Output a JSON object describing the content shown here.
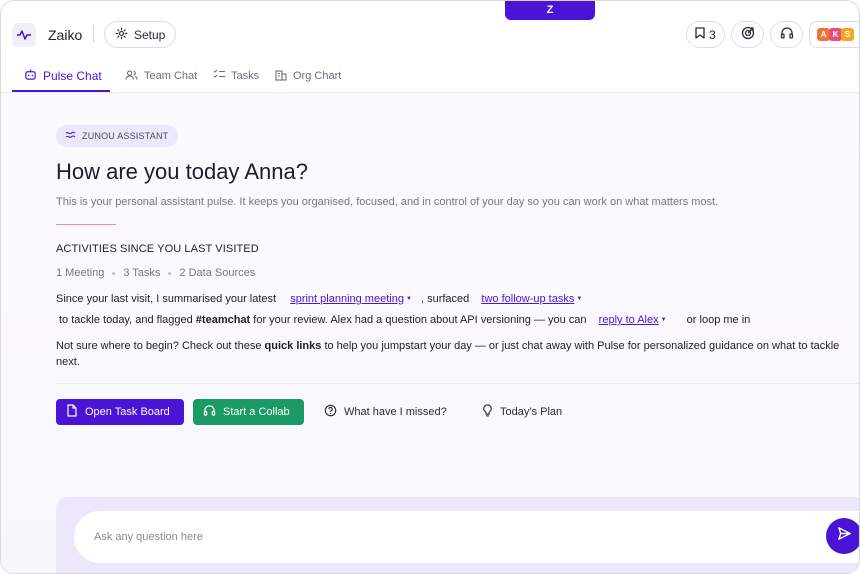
{
  "notch": {
    "label": "Z"
  },
  "header": {
    "brand": "Zaiko",
    "setup_label": "Setup",
    "bookmark_count": "3",
    "avatars": [
      {
        "letter": "A",
        "color": "#f0753b"
      },
      {
        "letter": "K",
        "color": "#e64f7a"
      },
      {
        "letter": "S",
        "color": "#f5a623"
      }
    ]
  },
  "tabs": [
    {
      "label": "Pulse Chat",
      "icon": "bot-icon",
      "active": true
    },
    {
      "label": "Team Chat",
      "icon": "users-icon",
      "active": false
    },
    {
      "label": "Tasks",
      "icon": "checklist-icon",
      "active": false
    },
    {
      "label": "Org Chart",
      "icon": "building-icon",
      "active": false
    }
  ],
  "main": {
    "badge": "ZUNOU ASSISTANT",
    "greeting": "How are you today Anna?",
    "subtitle": "This is your personal assistant pulse. It keeps you organised, focused, and in control of your day so you can work on what matters most.",
    "section_title": "ACTIVITIES SINCE YOU LAST VISITED",
    "stats": [
      "1 Meeting",
      "3 Tasks",
      "2 Data Sources"
    ],
    "summary": {
      "part1": "Since your last visit, I summarised your latest",
      "link1": "sprint planning meeting",
      "part2": ", surfaced",
      "link2": "two follow-up tasks",
      "part3": "to tackle today, and flagged",
      "hashtag": "#teamchat",
      "part4": "for your review. Alex had a question about API versioning — you can",
      "link3": "reply to Alex",
      "part5": "or loop me in"
    },
    "guidance": {
      "part1": "Not sure where to begin? Check out these",
      "bold": "quick links",
      "part2": "to help you jumpstart your day — or just chat away with Pulse for personalized guidance on what to",
      "part3": "tackle next."
    },
    "actions": {
      "task_board": "Open Task Board",
      "collab": "Start a Collab",
      "missed": "What have I missed?",
      "plan": "Today’s Plan"
    }
  },
  "composer": {
    "placeholder": "Ask any question here"
  },
  "colors": {
    "accent": "#4a14d6",
    "green": "#1b9a66"
  }
}
